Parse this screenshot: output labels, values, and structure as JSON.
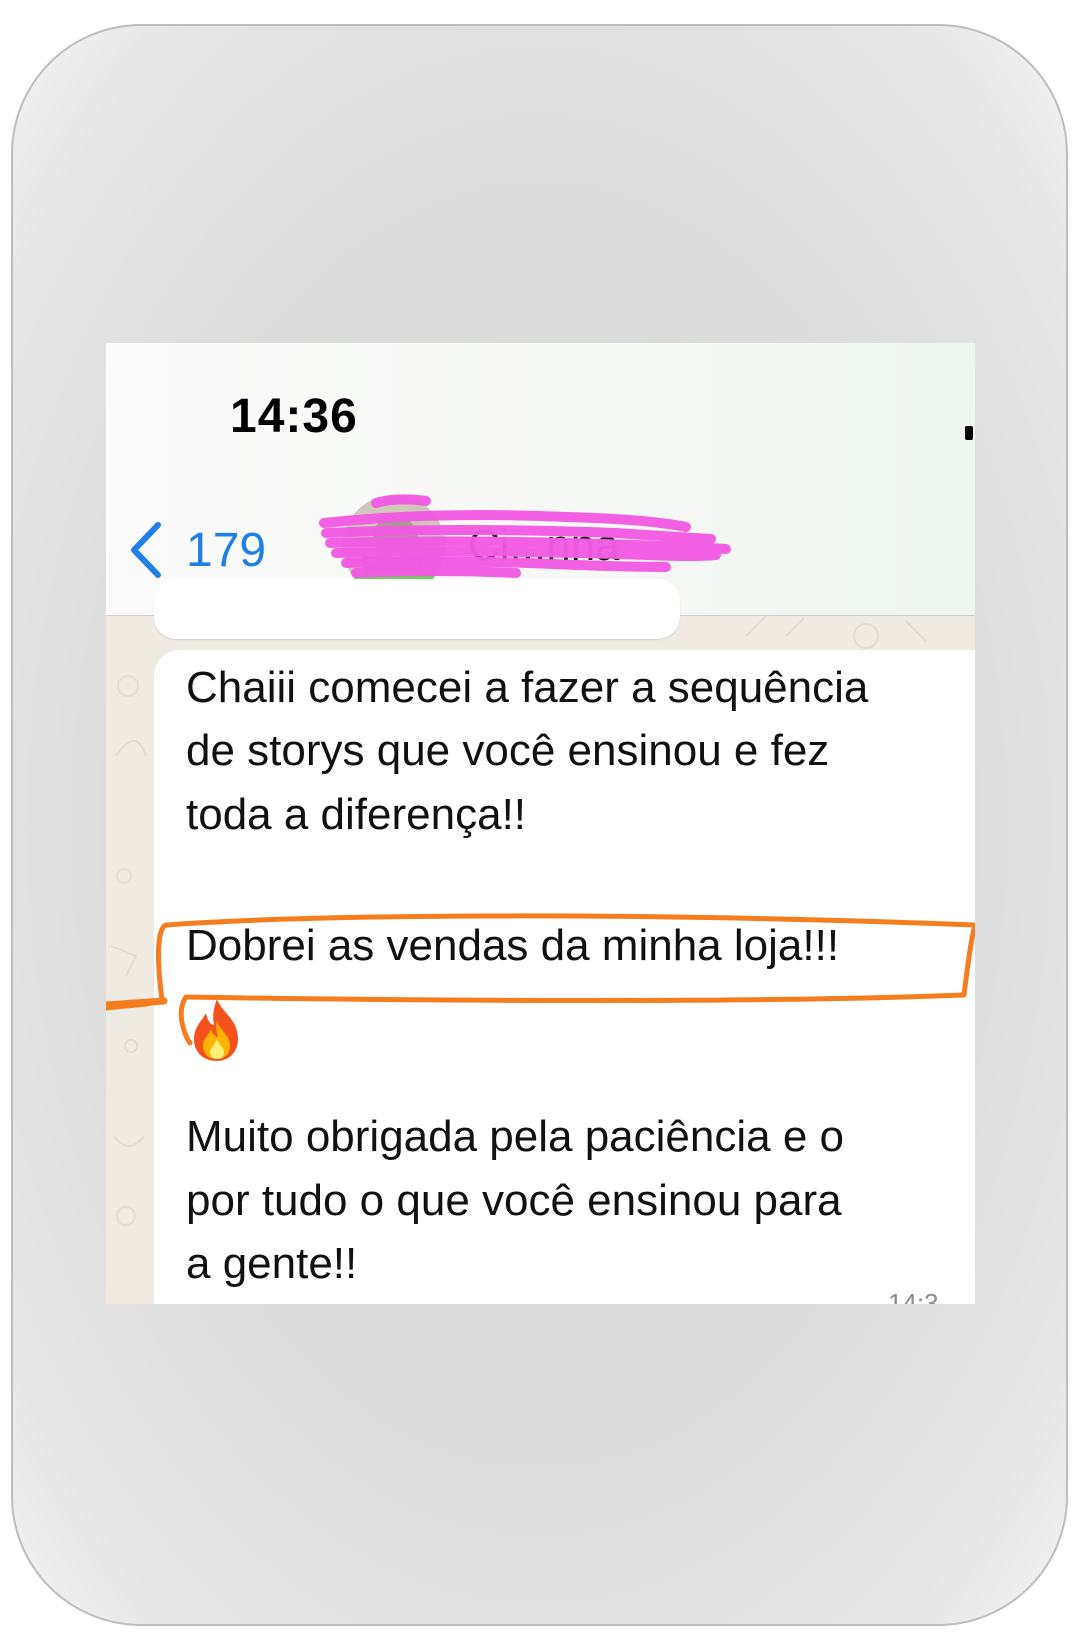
{
  "status_bar": {
    "time": "14:36"
  },
  "header": {
    "back_count": "179",
    "back_icon": "chevron-left-icon",
    "contact_name": "Ci...nna",
    "avatar": "contact-avatar"
  },
  "message": {
    "lines": [
      "Chaiii comecei a fazer a sequência",
      "de storys que você ensinou e fez",
      "toda a diferença!!",
      "Dobrei as vendas da minha loja!!!",
      "Muito obrigada pela paciência e o",
      "por tudo o que você ensinou para",
      "a gente!!"
    ],
    "emoji": "fire-icon",
    "timestamp": "14:3"
  },
  "colors": {
    "accent_blue": "#1f7fe6",
    "highlight_orange": "#f57c1f",
    "redaction_pink": "#f25ce3",
    "chat_background": "#efebe3",
    "bubble": "#ffffff"
  }
}
